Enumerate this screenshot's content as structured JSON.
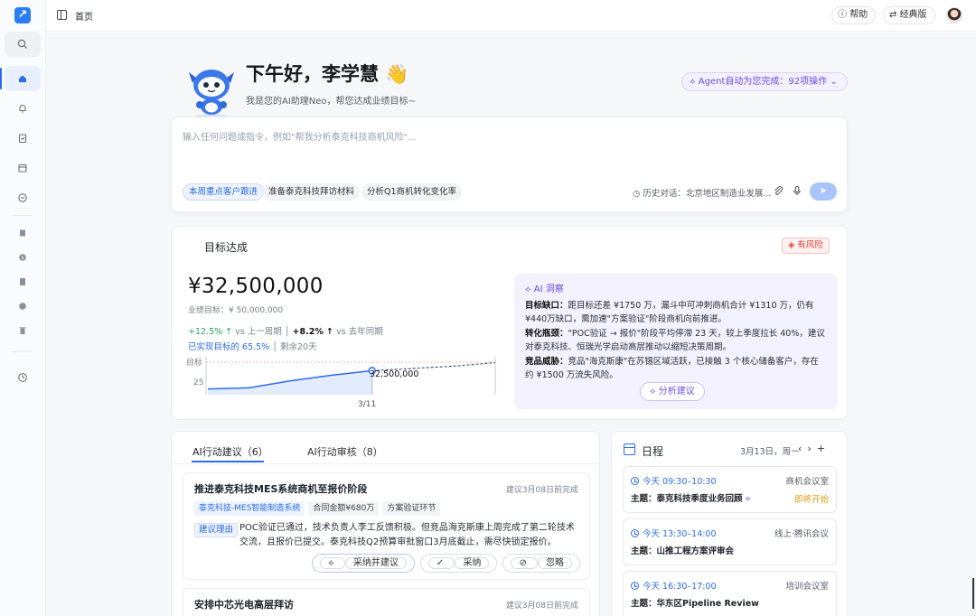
{
  "topbar": {
    "breadcrumb": "首页",
    "help_label": "帮助",
    "classic_label": "经典版"
  },
  "rail": {
    "icons": [
      "logo-icon",
      "search-icon",
      "home-icon",
      "bell-icon",
      "clipboard-icon",
      "calendar-icon",
      "minus-circle-icon",
      "book-icon",
      "dollar-icon",
      "document-icon",
      "w-icon",
      "trash-icon",
      "clock-icon"
    ]
  },
  "hero": {
    "greeting": "下午好，李学慧 👋",
    "subtitle": "我是您的AI助理Neo，帮您达成业绩目标~",
    "agent_pill": "Agent自动为您完成：92项操作"
  },
  "prompt": {
    "placeholder": "输入任何问题或指令，例如\"帮我分析泰克科技商机风险\"...",
    "chips": [
      "本周重点客户跟进",
      "准备泰克科技拜访材料",
      "分析Q1商机转化变化率"
    ],
    "history": "历史对话：北京地区制造业发展..."
  },
  "goal": {
    "title": "目标达成",
    "risk_badge": "有风险",
    "amount": "¥32,500,000",
    "target": "业绩目标：¥ 50,000,000",
    "metric1_value": "+12.5%",
    "metric1_label": "vs 上一周期",
    "metric2_value": "+8.2%",
    "metric2_label": "vs 去年同期",
    "achieved_label": "已实现目标的 65.5%",
    "remaining": "剩余20天",
    "chart_label_target": "目标",
    "chart_label_25": "25",
    "chart_point_label": "32,500,000",
    "chart_date": "3/11"
  },
  "chart_data": {
    "type": "line",
    "x": [
      "",
      "",
      "",
      "",
      "3/11",
      "",
      "",
      ""
    ],
    "series": [
      {
        "values": [
          24.5,
          25,
          28,
          30.5,
          32.5,
          null,
          null,
          null
        ]
      },
      {
        "values": [
          null,
          null,
          null,
          null,
          32.5,
          33.5,
          34.5,
          36
        ]
      }
    ],
    "yticks": [
      "25",
      "目标"
    ],
    "grid": false
  },
  "insight": {
    "title": "AI 洞察",
    "gap_label": "目标缺口：",
    "gap_text": "距目标还差 ¥1750 万，漏斗中可冲刺商机合计 ¥1310 万，仍有¥440万缺口，需加速\"方案验证\"阶段商机向前推进。",
    "conv_label": "转化瓶颈：",
    "conv_text": "\"POC验证 → 报价\"阶段平均停滞 23 天，较上季度拉长 40%，建议对泰克科技、恒瑞光学启动高层推动以缩短决策周期。",
    "comp_label": "竞品威胁：",
    "comp_text": "竞品\"海克斯康\"在苏锡区域活跃，已接触 3 个核心储备客户，存在约 ¥1500 万流失风险。",
    "button": "分析建议"
  },
  "actions": {
    "tab1": "AI行动建议（6）",
    "tab2": "AI行动审核（8）",
    "items": [
      {
        "title": "推进泰克科技MES系统商机至报价阶段",
        "due": "建议3月08日前完成",
        "tags": [
          "泰克科技-MES智能制造系统",
          "合同金额¥680万",
          "方案验证环节"
        ],
        "reason_label": "建议理由",
        "reason": "POC验证已通过，技术负责人李工反馈积极。但竞品海克斯康上周完成了第二轮技术交流，且报价已提交。泰克科技Q2预算审批窗口3月底截止，需尽快锁定报价。",
        "btn_accept_suggest": "采纳并建议",
        "btn_accept": "采纳",
        "btn_ignore": "忽略"
      },
      {
        "title": "安排中芯光电高层拜访",
        "due": "建议3月08日前完成"
      }
    ]
  },
  "schedule": {
    "title": "日程",
    "date": "3月13日，周一",
    "events": [
      {
        "time": "今天 09:30–10:30",
        "location": "商机会议室",
        "subject": "主题：泰克科技季度业务回顾",
        "status": "即将开始"
      },
      {
        "time": "今天 13:30–14:00",
        "location": "线上·腾讯会议",
        "subject": "主题：山推工程方案评审会"
      },
      {
        "time": "今天 16:30–17:00",
        "location": "培训会议室",
        "subject": "主题：华东区Pipeline Review"
      }
    ]
  },
  "colors": {
    "accent": "#2a6bf0",
    "agent_purple": "#6a4de8",
    "risk_red": "#e0423a",
    "positive_green": "#23a65f",
    "pending_orange": "#d99a12"
  }
}
